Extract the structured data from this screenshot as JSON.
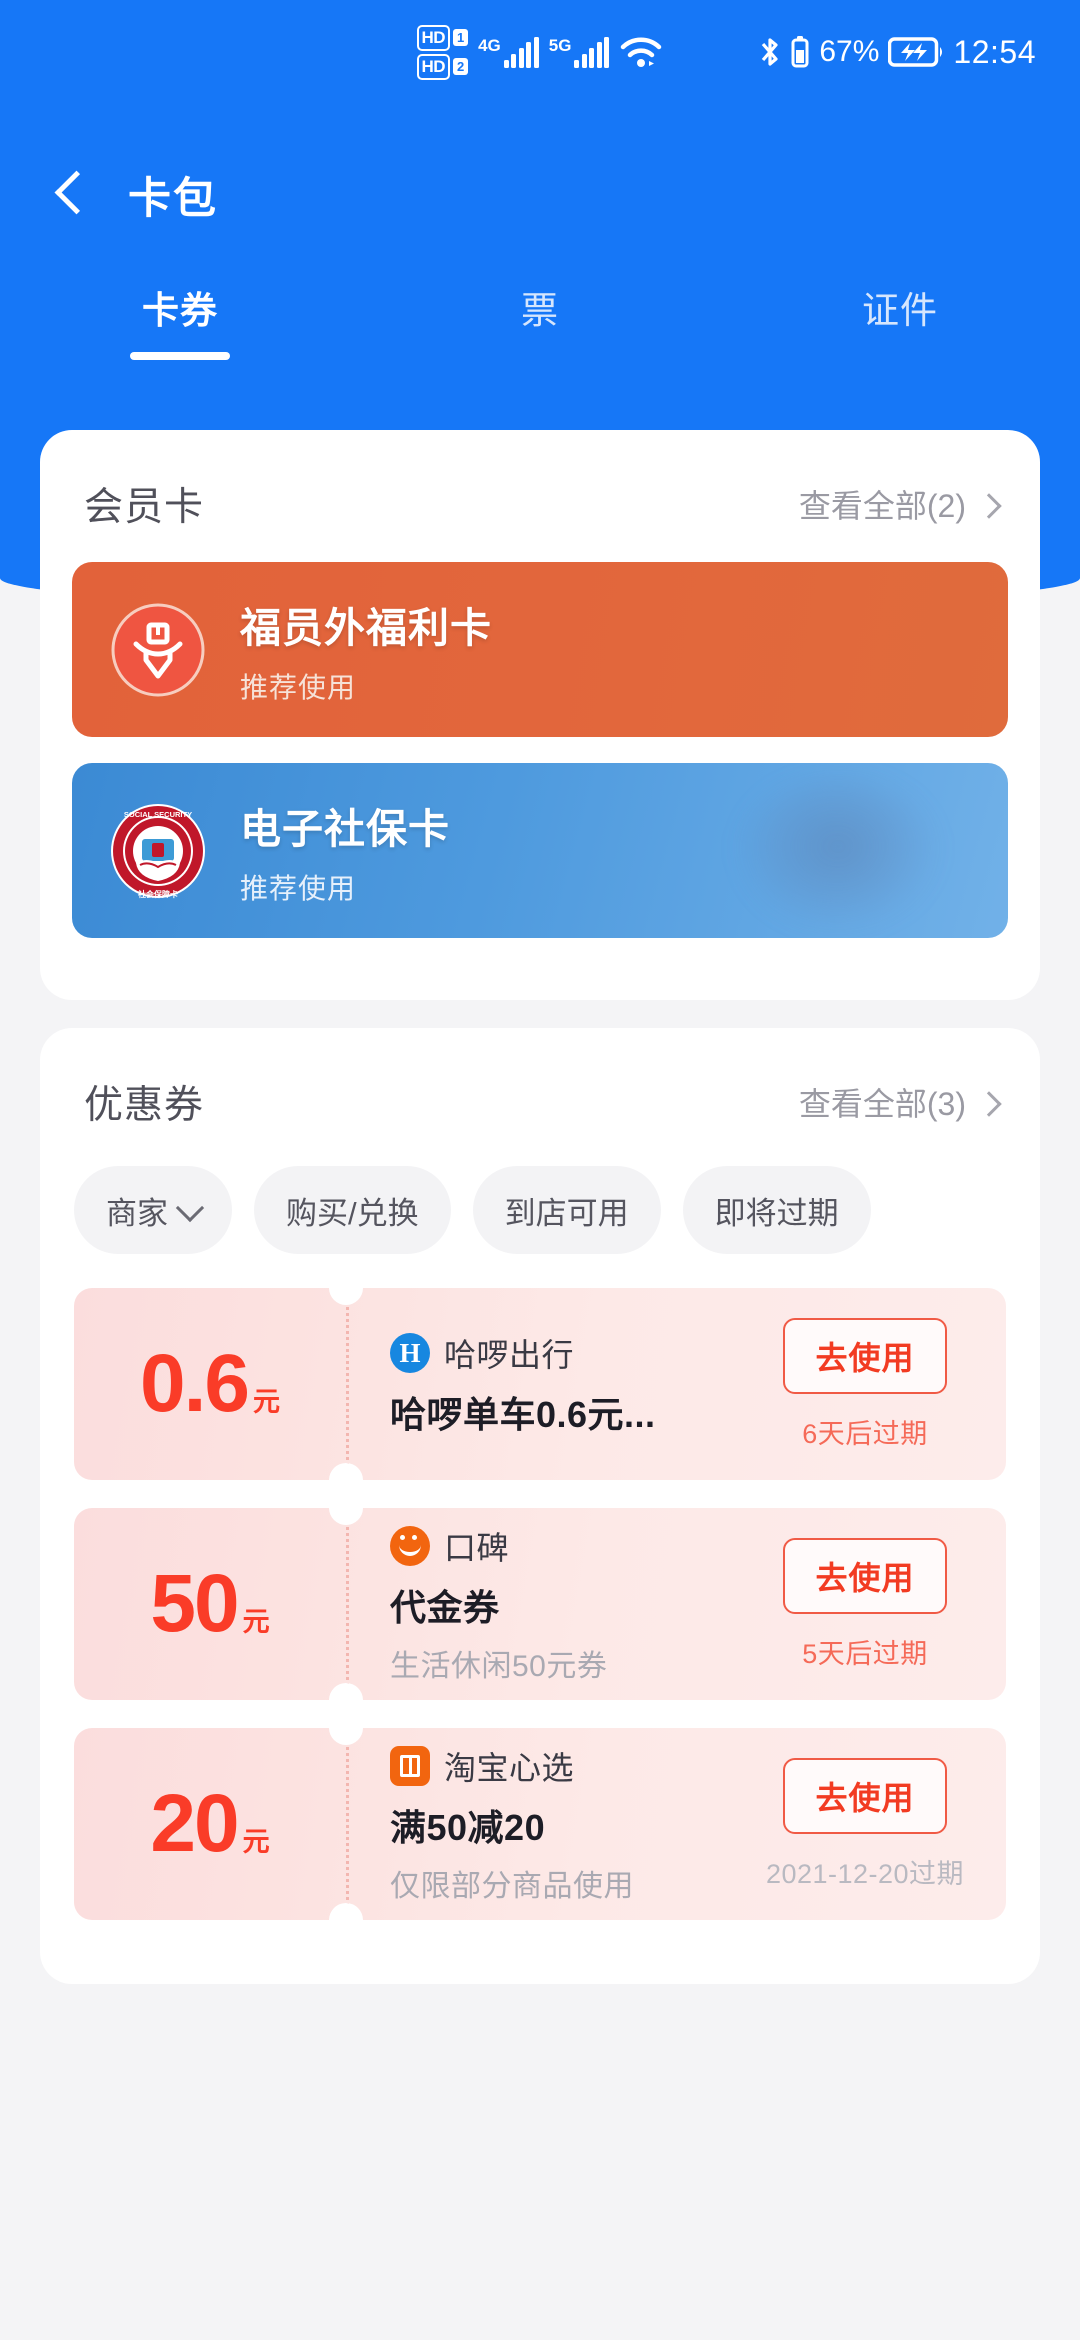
{
  "status_bar": {
    "hd1_label": "HD",
    "hd1_sim": "1",
    "hd2_label": "HD",
    "hd2_sim": "2",
    "net1": "4G",
    "net2": "5G",
    "wifi_icon": "wifi-icon",
    "bluetooth_icon": "bluetooth-icon",
    "battery_percent": "67%",
    "charging_icon": "battery-charging-icon",
    "time": "12:54"
  },
  "navbar": {
    "back_icon": "back-chevron-icon",
    "title": "卡包"
  },
  "tabs": [
    {
      "label": "卡券",
      "active": true
    },
    {
      "label": "票",
      "active": false
    },
    {
      "label": "证件",
      "active": false
    }
  ],
  "member_section": {
    "title": "会员卡",
    "more_label": "查看全部(2)",
    "cards": [
      {
        "title": "福员外福利卡",
        "subtitle": "推荐使用",
        "logo": "fuyuanwai-logo-icon",
        "theme": "orange",
        "color": "#e2673c"
      },
      {
        "title": "电子社保卡",
        "subtitle": "推荐使用",
        "logo": "social-security-card-logo-icon",
        "theme": "blue",
        "color": "#4e9ade"
      }
    ]
  },
  "coupon_section": {
    "title": "优惠券",
    "more_label": "查看全部(3)",
    "filters": [
      {
        "label": "商家",
        "has_dropdown": true
      },
      {
        "label": "购买/兑换",
        "has_dropdown": false
      },
      {
        "label": "到店可用",
        "has_dropdown": false
      },
      {
        "label": "即将过期",
        "has_dropdown": false
      }
    ],
    "action_label": "去使用",
    "coupons": [
      {
        "amount": "0.6",
        "unit": "元",
        "brand": "哈啰出行",
        "brand_logo": "hello-chuxing-logo-icon",
        "title": "哈啰单车0.6元...",
        "desc": "",
        "expiry": "6天后过期",
        "expiry_muted": false
      },
      {
        "amount": "50",
        "unit": "元",
        "brand": "口碑",
        "brand_logo": "koubei-logo-icon",
        "title": "代金券",
        "desc": "生活休闲50元券",
        "expiry": "5天后过期",
        "expiry_muted": false
      },
      {
        "amount": "20",
        "unit": "元",
        "brand": "淘宝心选",
        "brand_logo": "taobao-xinxuan-logo-icon",
        "title": "满50减20",
        "desc": "仅限部分商品使用",
        "expiry": "2021-12-20过期",
        "expiry_muted": true
      }
    ]
  },
  "theme": {
    "header_blue": "#1677f7",
    "accent_red": "#fa3c28",
    "coupon_bg": "#fce3e1"
  }
}
